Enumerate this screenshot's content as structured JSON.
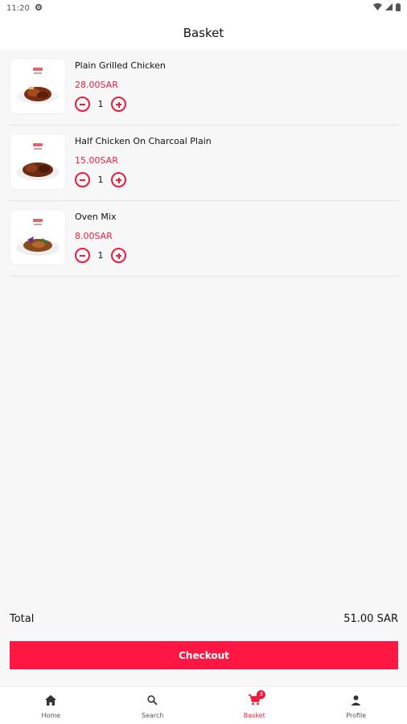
{
  "status_bar": {
    "time": "11:20"
  },
  "header": {
    "title": "Basket"
  },
  "basket": {
    "items": [
      {
        "name": "Plain Grilled Chicken",
        "price": "28.00SAR",
        "quantity": "1"
      },
      {
        "name": "Half Chicken On Charcoal Plain",
        "price": "15.00SAR",
        "quantity": "1"
      },
      {
        "name": "Oven Mix",
        "price": "8.00SAR",
        "quantity": "1"
      }
    ]
  },
  "summary": {
    "total_label": "Total",
    "total_value": "51.00 SAR",
    "checkout_label": "Checkout"
  },
  "bottom_nav": {
    "tabs": [
      {
        "label": "Home",
        "icon": "home-icon"
      },
      {
        "label": "Search",
        "icon": "search-icon"
      },
      {
        "label": "Basket",
        "icon": "cart-icon",
        "badge": "3"
      },
      {
        "label": "Profile",
        "icon": "person-icon"
      }
    ],
    "active_tab": "Basket"
  },
  "colors": {
    "accent": "#ec1c3d",
    "checkout_bg": "#ff1744",
    "background": "#f7f7f7"
  }
}
